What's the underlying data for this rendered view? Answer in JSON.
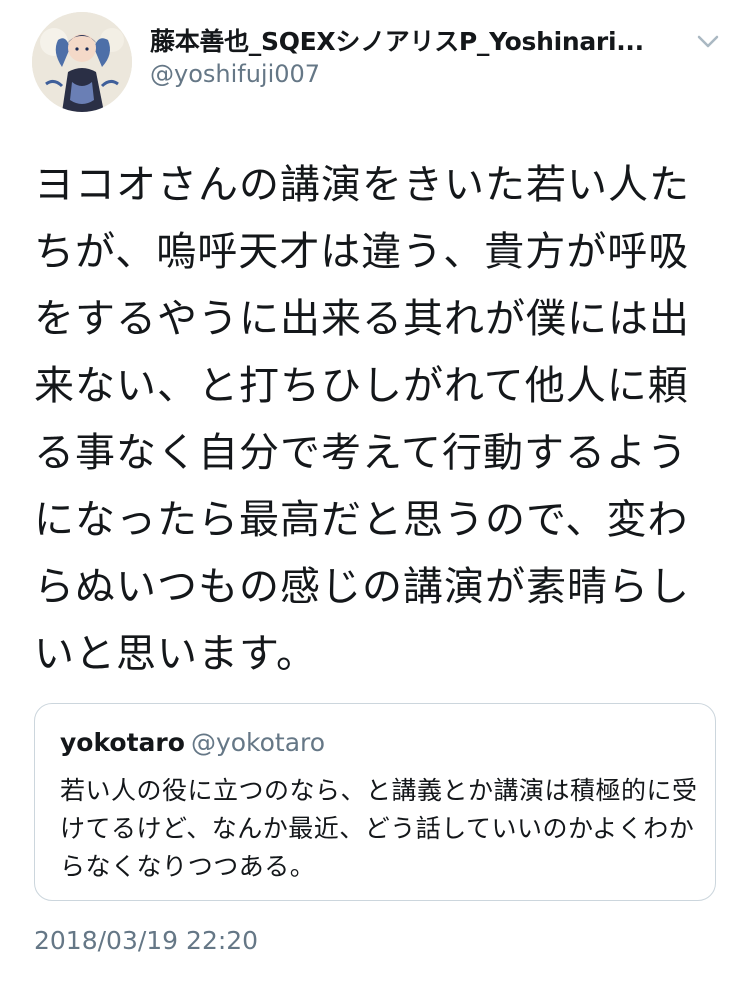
{
  "author": {
    "display_name": "藤本善也_SQEXシノアリスP_Yoshinari...",
    "handle": "@yoshifuji007",
    "avatar_icon": "anime-character-avatar"
  },
  "tweet": {
    "text": "ヨコオさんの講演をきいた若い人たちが、嗚呼天才は違う、貴方が呼吸をするやうに出来る其れが僕には出来ない、と打ちひしがれて他人に頼る事なく自分で考えて行動するようになったら最高だと思うので、変わらぬいつもの感じの講演が素晴らしいと思います。",
    "timestamp": "2018/03/19 22:20"
  },
  "quoted_tweet": {
    "display_name": "yokotaro",
    "handle": "@yokotaro",
    "text": "若い人の役に立つのなら、と講義とか講演は積極的に受けてるけど、なんか最近、どう話していいのかよくわからなくなりつつある。"
  },
  "icons": {
    "menu": "chevron-down-icon"
  },
  "colors": {
    "text_primary": "#14171a",
    "text_secondary": "#657786",
    "border": "#ccd6dd"
  }
}
